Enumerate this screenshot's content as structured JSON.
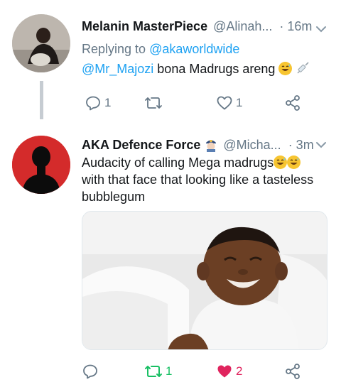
{
  "tweets": [
    {
      "display_name": "Melanin MasterPiece",
      "handle": "@Alinah...",
      "time": "· 16m",
      "replying_label": "Replying to",
      "replying_to": "@akaworldwide",
      "text_mention": "@Mr_Majozi",
      "text": " bona Madrugs areng",
      "actions": {
        "reply_count": "1",
        "retweet_count": "",
        "like_count": "1"
      }
    },
    {
      "display_name": "AKA Defence Force",
      "handle": "@Micha...",
      "time": "· 3m",
      "text_line1": "Audacity of calling Mega madrugs",
      "text_rest": "with that face that looking like a tasteless bubblegum",
      "actions": {
        "reply_count": "",
        "retweet_count": "1",
        "like_count": "2"
      }
    }
  ],
  "icons": {
    "reply": "reply-icon",
    "retweet": "retweet-icon",
    "like": "heart-icon",
    "share": "share-icon",
    "menu": "chevron-down-icon"
  },
  "colors": {
    "accent": "#1da1f2",
    "muted": "#657786",
    "retweet_active": "#17bf63",
    "like_active": "#e0245e"
  }
}
